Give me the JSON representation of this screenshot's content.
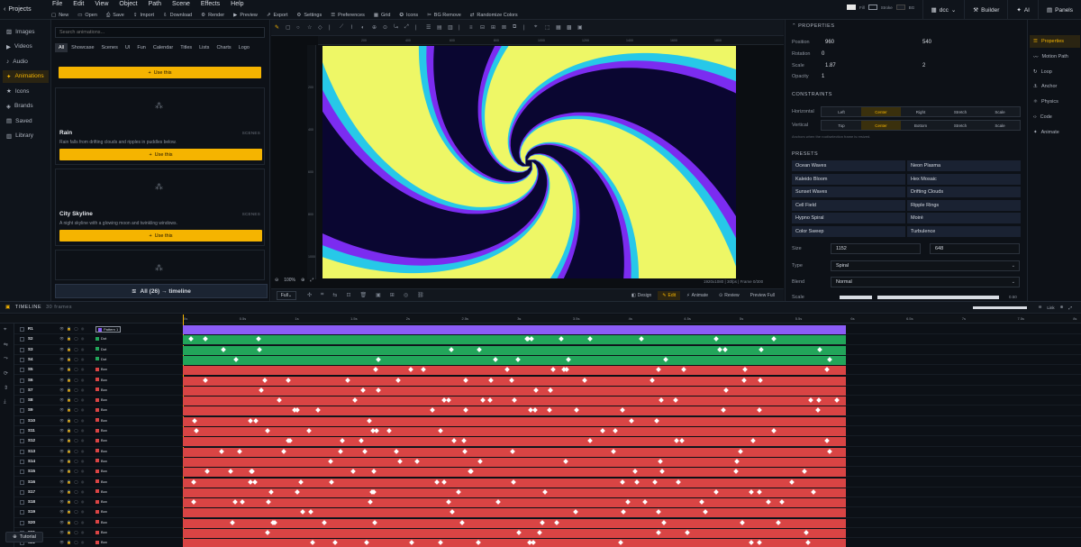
{
  "menubar": {
    "projects": "Projects",
    "menus": [
      "File",
      "Edit",
      "View",
      "Object",
      "Path",
      "Scene",
      "Effects",
      "Help"
    ],
    "toolbar": [
      "New",
      "Open",
      "Save",
      "Import",
      "Download",
      "Render",
      "Preview",
      "Export",
      "Settings",
      "Preferences",
      "Grid",
      "Icons",
      "BG Remove",
      "Randomize Colors"
    ],
    "fill_label": "Fill",
    "stroke_label": "Stroke",
    "bg_label": "BG",
    "doc": "dcc",
    "builder": "Builder",
    "ai": "AI",
    "panels": "Panels"
  },
  "sidebar": [
    "Images",
    "Videos",
    "Audio",
    "Animations",
    "Icons",
    "Brands",
    "Saved",
    "Library"
  ],
  "library": {
    "search_placeholder": "Search animations...",
    "categories": [
      "All",
      "Showcase",
      "Scenes",
      "UI",
      "Fun",
      "Calendar",
      "Titles",
      "Lists",
      "Charts",
      "Logo"
    ],
    "use_label": "Use this",
    "cards": [
      {
        "title": "Rain",
        "tag": "SCENES",
        "desc": "Rain falls from drifting clouds and ripples in puddles below."
      },
      {
        "title": "City Skyline",
        "tag": "SCENES",
        "desc": "A night skyline with a glowing moon and twinkling windows."
      }
    ],
    "all_timeline": "All (26) → timeline"
  },
  "canvas": {
    "info": "1920x1080 | 30fps | Frame 0/300",
    "zoom": "100%",
    "full": "Full",
    "modes": [
      "Design",
      "Edit",
      "Animate",
      "Review"
    ],
    "preview_full": "Preview Full",
    "hticks": [
      "200",
      "400",
      "600",
      "800",
      "1000",
      "1200",
      "1400",
      "1600",
      "1800"
    ],
    "vticks": [
      "200",
      "400",
      "600",
      "800",
      "1000"
    ]
  },
  "properties": {
    "title": "PROPERTIES",
    "position_label": "Position",
    "pos_x": "960",
    "pos_y": "540",
    "rotation_label": "Rotation",
    "rotation": "0",
    "scale_label": "Scale",
    "scale_x": "1.87",
    "scale_y": "2",
    "opacity_label": "Opacity",
    "opacity": "1",
    "constraints_title": "CONSTRAINTS",
    "horizontal_label": "Horizontal",
    "h_options": [
      "Left",
      "Center",
      "Right",
      "Stretch",
      "Scale"
    ],
    "h_active": 1,
    "vertical_label": "Vertical",
    "v_options": [
      "Top",
      "Center",
      "Bottom",
      "Stretch",
      "Scale"
    ],
    "v_active": 1,
    "constraint_note": "Anchors when the root/selection frame is resized.",
    "presets_title": "PRESETS",
    "presets": [
      "Ocean Waves",
      "Neon Plasma",
      "Kaleido Bloom",
      "Hex Mosaic",
      "Sunset Waves",
      "Drifting Clouds",
      "Cell Field",
      "Ripple Rings",
      "Hypno Spiral",
      "Moiré",
      "Color Sweep",
      "Turbulence"
    ],
    "size_label": "Size",
    "size_w": "1152",
    "size_h": "648",
    "type_label": "Type",
    "type": "Spiral",
    "blend_label": "Blend",
    "blend": "Normal",
    "scale2_label": "Scale",
    "scale2": "0.50"
  },
  "right_tabs": [
    "Properties",
    "Motion Path",
    "Loop",
    "Anchor",
    "Physics",
    "Code",
    "Animate"
  ],
  "timeline": {
    "title": "TIMELINE",
    "frames": "30 frames",
    "ticks": [
      "0s",
      "0.5s",
      "1s",
      "1.5s",
      "2s",
      "2.5s",
      "3s",
      "3.5s",
      "4s",
      "4.5s",
      "5s",
      "5.5s",
      "6s",
      "6.5s",
      "7s",
      "7.5s",
      "8s"
    ],
    "zoom_label": "Link",
    "tutorial": "Tutorial",
    "rows": [
      {
        "name": "R1",
        "type": "Pattern 1",
        "color": "#8b5cf6"
      },
      {
        "name": "S2",
        "type": "Dot",
        "color": "#22a55a"
      },
      {
        "name": "S3",
        "type": "Dot",
        "color": "#22a55a"
      },
      {
        "name": "S4",
        "type": "Dot",
        "color": "#22a55a"
      },
      {
        "name": "S5",
        "type": "Box",
        "color": "#d94444"
      },
      {
        "name": "S6",
        "type": "Box",
        "color": "#d94444"
      },
      {
        "name": "S7",
        "type": "Box",
        "color": "#d94444"
      },
      {
        "name": "S8",
        "type": "Box",
        "color": "#d94444"
      },
      {
        "name": "S9",
        "type": "Box",
        "color": "#d94444"
      },
      {
        "name": "S10",
        "type": "Box",
        "color": "#d94444"
      },
      {
        "name": "S11",
        "type": "Box",
        "color": "#d94444"
      },
      {
        "name": "S12",
        "type": "Box",
        "color": "#d94444"
      },
      {
        "name": "S13",
        "type": "Box",
        "color": "#d94444"
      },
      {
        "name": "S14",
        "type": "Box",
        "color": "#d94444"
      },
      {
        "name": "S15",
        "type": "Box",
        "color": "#d94444"
      },
      {
        "name": "S16",
        "type": "Box",
        "color": "#d94444"
      },
      {
        "name": "S17",
        "type": "Box",
        "color": "#d94444"
      },
      {
        "name": "S18",
        "type": "Box",
        "color": "#d94444"
      },
      {
        "name": "S19",
        "type": "Box",
        "color": "#d94444"
      },
      {
        "name": "S20",
        "type": "Box",
        "color": "#d94444"
      },
      {
        "name": "S21",
        "type": "Box",
        "color": "#d94444"
      },
      {
        "name": "S22",
        "type": "Box",
        "color": "#d94444"
      }
    ]
  },
  "colors": {
    "accent": "#f5b400",
    "spiral_a": "#eef766",
    "spiral_b": "#0a0631",
    "spiral_c": "#7b2cf0",
    "spiral_d": "#27c8e8"
  }
}
